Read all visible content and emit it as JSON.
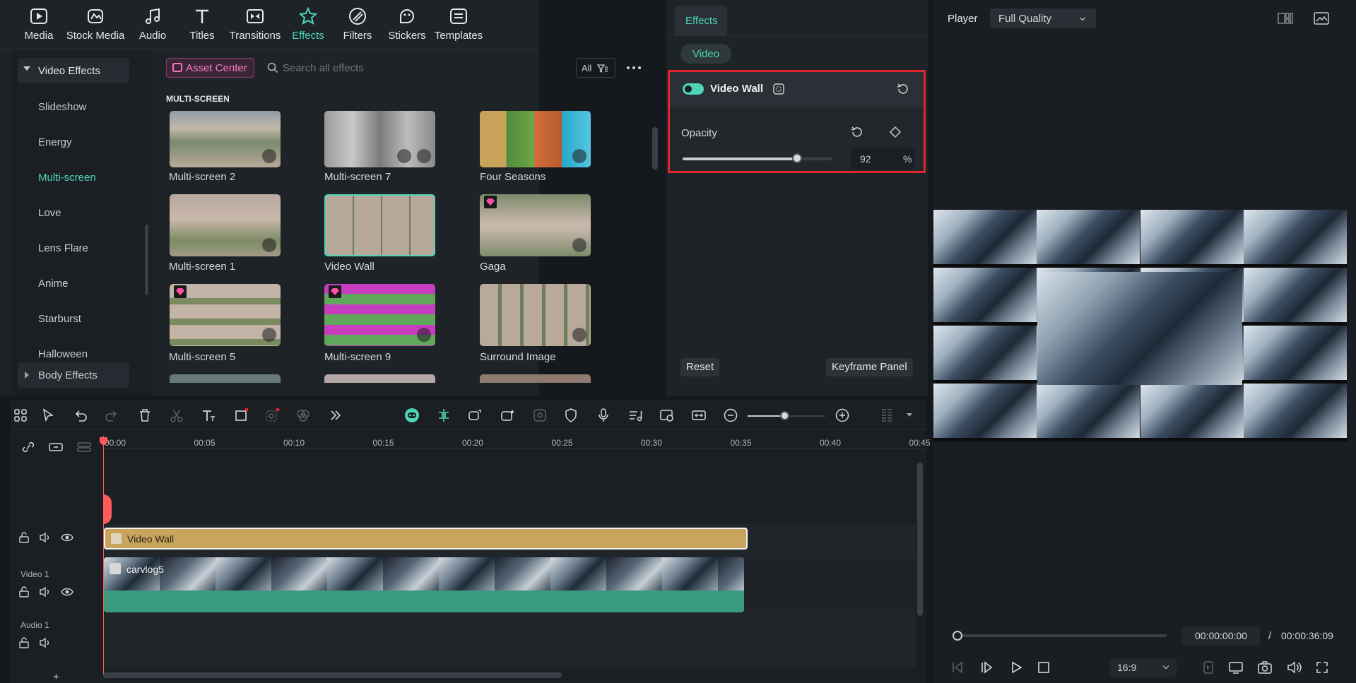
{
  "toolbar": {
    "items": [
      {
        "label": "Media",
        "icon": "media-icon"
      },
      {
        "label": "Stock Media",
        "icon": "stock-media-icon"
      },
      {
        "label": "Audio",
        "icon": "audio-icon"
      },
      {
        "label": "Titles",
        "icon": "titles-icon"
      },
      {
        "label": "Transitions",
        "icon": "transitions-icon"
      },
      {
        "label": "Effects",
        "icon": "effects-icon"
      },
      {
        "label": "Filters",
        "icon": "filters-icon"
      },
      {
        "label": "Stickers",
        "icon": "stickers-icon"
      },
      {
        "label": "Templates",
        "icon": "templates-icon"
      }
    ],
    "active": "Effects"
  },
  "sidebar": {
    "header": "Video Effects",
    "items": [
      "Slideshow",
      "Energy",
      "Multi-screen",
      "Love",
      "Lens Flare",
      "Anime",
      "Starburst",
      "Halloween"
    ],
    "active": "Multi-screen",
    "footer": "Body Effects"
  },
  "browser": {
    "asset_center": "Asset Center",
    "search_placeholder": "Search all effects",
    "filter_label": "All",
    "section": "MULTI-SCREEN",
    "effects": [
      "Multi-screen 2",
      "Multi-screen 7",
      "Four Seasons",
      "Multi-screen 1",
      "Video Wall",
      "Gaga",
      "Multi-screen 5",
      "Multi-screen 9",
      "Surround Image"
    ]
  },
  "effects_panel": {
    "tab": "Effects",
    "subtab": "Video",
    "effect_name": "Video Wall",
    "opacity_label": "Opacity",
    "opacity_value": "92",
    "opacity_unit": "%",
    "opacity_fraction": 0.92,
    "reset": "Reset",
    "keyframe_panel": "Keyframe Panel"
  },
  "player": {
    "label": "Player",
    "quality": "Full Quality",
    "current_time": "00:00:00:00",
    "separator": "/",
    "total_time": "00:00:36:09",
    "aspect": "16:9"
  },
  "timeline": {
    "ruler": [
      "00:00",
      "00:05",
      "00:10",
      "00:15",
      "00:20",
      "00:25",
      "00:30",
      "00:35",
      "00:40",
      "00:45"
    ],
    "effect_clip": "Video Wall",
    "video_track": "Video 1",
    "video_clip": "carvlog5",
    "audio_track": "Audio 1"
  },
  "colors": {
    "accent": "#4ed5b8",
    "highlight": "#e0262f",
    "effect_clip": "#c9a45c",
    "video_clip": "#3a9a80"
  }
}
